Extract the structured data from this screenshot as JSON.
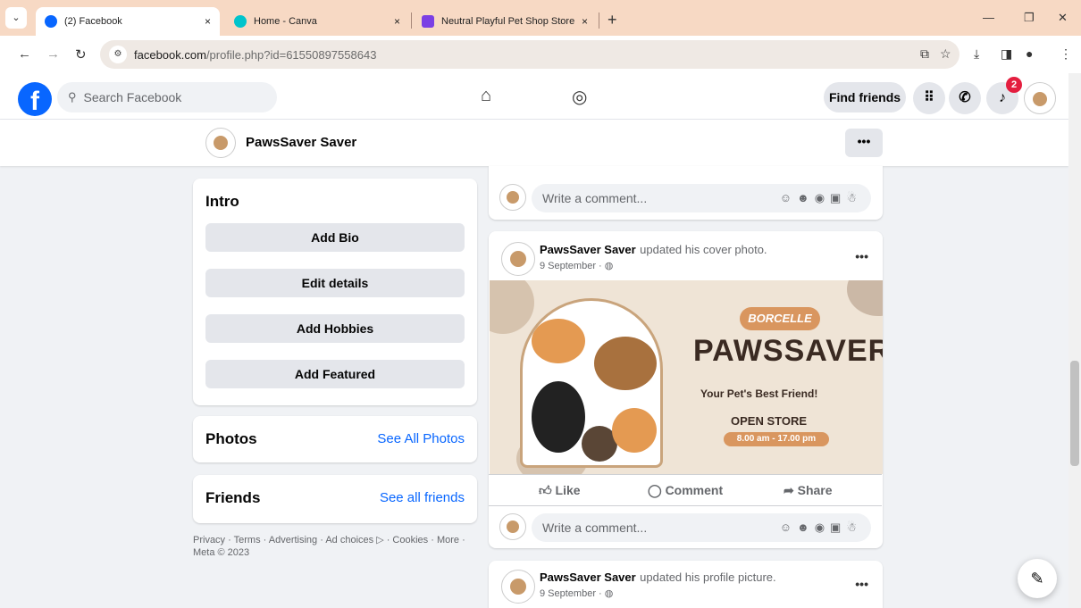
{
  "browser": {
    "tabs": [
      {
        "title": "(2) Facebook",
        "active": true,
        "favicon_color": "#0866ff"
      },
      {
        "title": "Home - Canva",
        "active": false,
        "favicon_color": "#00c4cc"
      },
      {
        "title": "Neutral Playful Pet Shop Store",
        "active": false,
        "favicon_color": "#7b3fe4"
      }
    ],
    "tab_close_glyph": "×",
    "new_tab_glyph": "+",
    "url_host": "facebook.com",
    "url_path": "/profile.php?id=61550897558643"
  },
  "fb": {
    "logo": "f",
    "search_placeholder": "Search Facebook",
    "find_friends": "Find friends",
    "notification_count": "2",
    "accent": "#0866ff"
  },
  "profile": {
    "name": "PawsSaver Saver",
    "more_glyph": "•••"
  },
  "intro": {
    "heading": "Intro",
    "buttons": [
      "Add Bio",
      "Edit details",
      "Add Hobbies",
      "Add Featured"
    ]
  },
  "photos": {
    "heading": "Photos",
    "link": "See All Photos"
  },
  "friends": {
    "heading": "Friends",
    "link": "See all friends"
  },
  "footer": {
    "line1": "Privacy · Terms · Advertising · Ad choices ▷ · Cookies · More ·",
    "line2": "Meta © 2023"
  },
  "comment_placeholder": "Write a comment...",
  "posts": [
    {
      "author": "PawsSaver Saver",
      "action": "updated his cover photo.",
      "date": "9 September · "
    },
    {
      "author": "PawsSaver Saver",
      "action": "updated his profile picture.",
      "date": "9 September · "
    }
  ],
  "post_actions": {
    "like": "Like",
    "comment": "Comment",
    "share": "Share"
  },
  "cover": {
    "brand": "BORCELLE",
    "title": "PAWSSAVER",
    "tagline": "Your Pet's Best Friend!",
    "open": "OPEN STORE",
    "hours": "8.00 am - 17.00 pm"
  }
}
